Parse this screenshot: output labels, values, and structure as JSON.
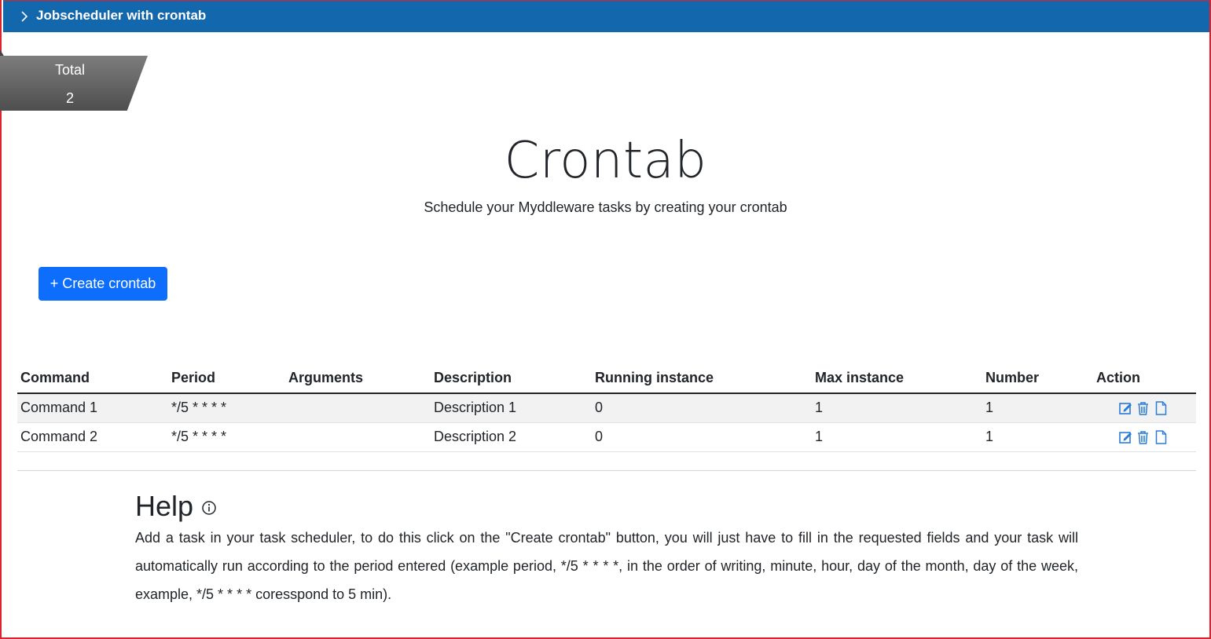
{
  "header": {
    "title": "Jobscheduler with crontab",
    "chevron_icon": "chevron-right-icon"
  },
  "total_badge": {
    "label": "Total",
    "value": "2"
  },
  "hero": {
    "title": "Crontab",
    "subtitle": "Schedule your Myddleware tasks by creating your crontab"
  },
  "create_button": {
    "label": "+ Create crontab"
  },
  "table": {
    "headers": [
      "Command",
      "Period",
      "Arguments",
      "Description",
      "Running instance",
      "Max instance",
      "Number",
      "Action"
    ],
    "rows": [
      {
        "command": "Command 1",
        "period": "*/5 * * * *",
        "arguments": "",
        "description": "Description 1",
        "running_instance": "0",
        "max_instance": "1",
        "number": "1"
      },
      {
        "command": "Command 2",
        "period": "*/5 * * * *",
        "arguments": "",
        "description": "Description 2",
        "running_instance": "0",
        "max_instance": "1",
        "number": "1"
      }
    ],
    "action_icons": [
      "edit-icon",
      "trash-icon",
      "document-icon"
    ]
  },
  "help": {
    "title": "Help",
    "info_icon": "info-icon",
    "text": "Add a task in your task scheduler, to do this click on the \"Create crontab\" button, you will just have to fill in the requested fields and your task will automatically run according to the period entered (example period, */5 * * * *, in the order of writing, minute, hour, day of the month, day of the week, example, */5 * * * * coresspond to 5 min)."
  },
  "colors": {
    "header_bg": "#1267ad",
    "primary_button": "#0d6efd",
    "action_icon": "#2b7bd8",
    "frame_border": "#d9232f"
  }
}
